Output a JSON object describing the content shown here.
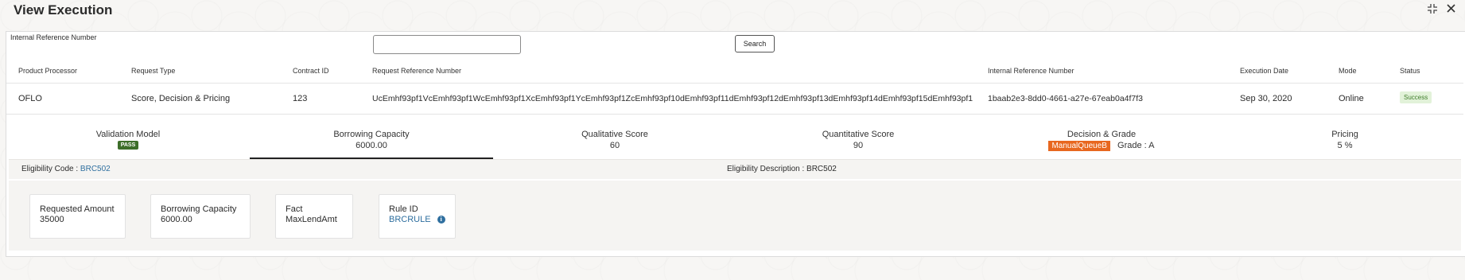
{
  "header": {
    "title": "View Execution"
  },
  "search": {
    "label": "Internal Reference Number",
    "value": "",
    "button_label": "Search"
  },
  "table": {
    "columns": [
      "Product Processor",
      "Request Type",
      "Contract ID",
      "Request Reference Number",
      "Internal Reference Number",
      "Execution Date",
      "Mode",
      "Status"
    ],
    "rows": [
      {
        "product_processor": "OFLO",
        "request_type": "Score, Decision & Pricing",
        "contract_id": "123",
        "request_reference_number": "UcEmhf93pf1VcEmhf93pf1WcEmhf93pf1XcEmhf93pf1YcEmhf93pf1ZcEmhf93pf10dEmhf93pf11dEmhf93pf12dEmhf93pf13dEmhf93pf14dEmhf93pf15dEmhf93pf1",
        "internal_reference_number": "1baab2e3-8dd0-4661-a27e-67eab0a4f7f3",
        "execution_date": "Sep 30, 2020",
        "mode": "Online",
        "status": "Success"
      }
    ]
  },
  "tabs": [
    {
      "label": "Validation Model",
      "value": "PASS",
      "kind": "badge"
    },
    {
      "label": "Borrowing Capacity",
      "value": "6000.00",
      "active": true
    },
    {
      "label": "Qualitative Score",
      "value": "60"
    },
    {
      "label": "Quantitative Score",
      "value": "90"
    },
    {
      "label": "Decision & Grade",
      "queue": "ManualQueueB",
      "grade": "Grade : A"
    },
    {
      "label": "Pricing",
      "value": "5 %"
    }
  ],
  "eligibility": {
    "code_label": "Eligibility Code : ",
    "code_value": "BRC502",
    "description": "Eligibility Description : BRC502"
  },
  "cards": [
    {
      "label": "Requested Amount",
      "value": "35000"
    },
    {
      "label": "Borrowing Capacity",
      "value": "6000.00"
    },
    {
      "label": "Fact",
      "value": "MaxLendAmt"
    },
    {
      "label": "Rule ID",
      "value": "BRCRULE"
    }
  ],
  "colors": {
    "success_bg": "#e2f2d9",
    "pass_bg": "#3d6e2a",
    "queue_bg": "#e8671f",
    "link": "#2f6f9f"
  },
  "icons": [
    "maximize-icon",
    "close-icon",
    "info-icon"
  ]
}
